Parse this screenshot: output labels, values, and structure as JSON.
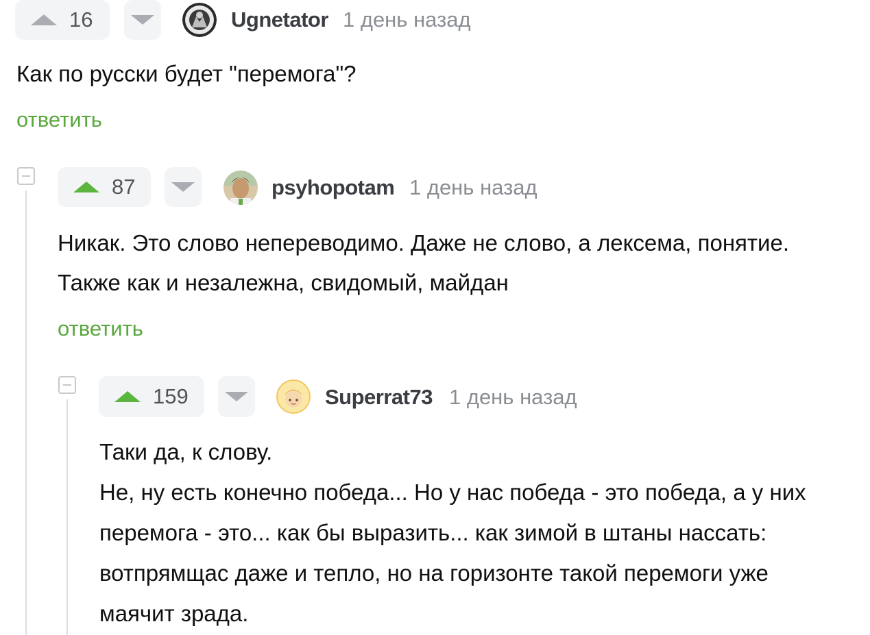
{
  "comments": [
    {
      "rating": "16",
      "username": "Ugnetator",
      "time": "1 день назад",
      "lines": [
        "Как по русски будет \"перемога\"?"
      ],
      "reply_label": "ответить"
    },
    {
      "rating": "87",
      "username": "psyhopotam",
      "time": "1 день назад",
      "lines": [
        "Никак. Это слово непереводимо. Даже не слово, а лексема, понятие.",
        "Также как и незалежна, свидомый, майдан"
      ],
      "reply_label": "ответить"
    },
    {
      "rating": "159",
      "username": "Superrat73",
      "time": "1 день назад",
      "lines": [
        "Таки да, к слову.",
        "Не, ну есть конечно победа... Но у нас победа - это победа, а у них",
        "перемога - это... как бы выразить... как зимой в штаны нассать:",
        "вотпрямщас даже и тепло, но на горизонте такой перемоги уже",
        "маячит зрада."
      ]
    }
  ],
  "colors": {
    "accent_green": "#5aa83d",
    "upvote_active": "#5bb53f",
    "muted": "#8a8e93"
  }
}
